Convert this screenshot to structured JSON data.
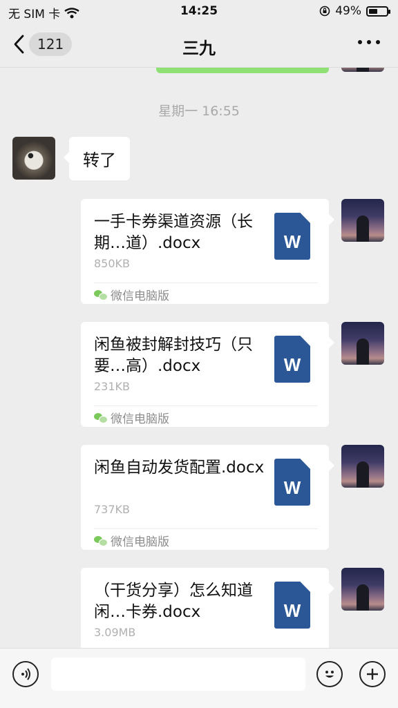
{
  "status_bar": {
    "carrier": "无 SIM 卡",
    "time": "14:25",
    "battery_percent": "49%",
    "battery_level": 0.49
  },
  "nav": {
    "back_count": "121",
    "title": "三九"
  },
  "chat": {
    "timestamp": "星期一 16:55",
    "incoming_message": "转了",
    "files": [
      {
        "name": "一手卡券渠道资源（长期…道）.docx",
        "size": "850KB",
        "source": "微信电脑版"
      },
      {
        "name": "闲鱼被封解封技巧（只要…高）.docx",
        "size": "231KB",
        "source": "微信电脑版"
      },
      {
        "name": "闲鱼自动发货配置.docx",
        "size": "737KB",
        "source": "微信电脑版"
      },
      {
        "name": "（干货分享）怎么知道闲…卡券.docx",
        "size": "3.09MB",
        "source": ""
      }
    ],
    "word_icon_letter": "W"
  },
  "colors": {
    "background": "#ededed",
    "sent_green": "#8fe176",
    "word_blue": "#2b5797"
  }
}
